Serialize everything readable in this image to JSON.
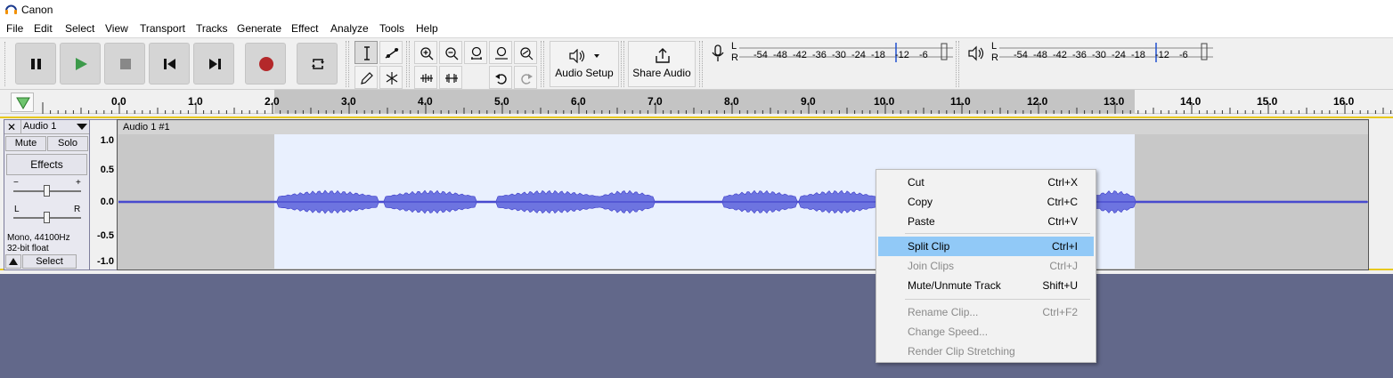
{
  "window": {
    "title": "Canon"
  },
  "menubar": [
    "File",
    "Edit",
    "Select",
    "View",
    "Transport",
    "Tracks",
    "Generate",
    "Effect",
    "Analyze",
    "Tools",
    "Help"
  ],
  "toolbar": {
    "audio_setup_label": "Audio Setup",
    "share_audio_label": "Share Audio"
  },
  "meters": {
    "record_channels": [
      "L",
      "R"
    ],
    "playback_channels": [
      "L",
      "R"
    ],
    "scale": [
      "-54",
      "-48",
      "-42",
      "-36",
      "-30",
      "-24",
      "-18",
      "-12",
      "-6"
    ]
  },
  "ruler": {
    "labels": [
      "0.0",
      "1.0",
      "2.0",
      "3.0",
      "4.0",
      "5.0",
      "6.0",
      "7.0",
      "8.0",
      "9.0",
      "10.0",
      "11.0",
      "12.0",
      "13.0",
      "14.0",
      "15.0",
      "16.0"
    ]
  },
  "track": {
    "name": "Audio 1",
    "mute_label": "Mute",
    "solo_label": "Solo",
    "effects_label": "Effects",
    "gain_minus": "−",
    "gain_plus": "+",
    "pan_left": "L",
    "pan_right": "R",
    "info_line1": "Mono, 44100Hz",
    "info_line2": "32-bit float",
    "select_label": "Select",
    "clip_name": "Audio 1 #1",
    "vertical_scale": [
      "1.0",
      "0.5",
      "0.0",
      "-0.5",
      "-1.0"
    ]
  },
  "context_menu": {
    "items": [
      {
        "label": "Cut",
        "shortcut": "Ctrl+X",
        "enabled": true
      },
      {
        "label": "Copy",
        "shortcut": "Ctrl+C",
        "enabled": true
      },
      {
        "label": "Paste",
        "shortcut": "Ctrl+V",
        "enabled": true
      },
      {
        "label": "Split Clip",
        "shortcut": "Ctrl+I",
        "enabled": true,
        "highlighted": true
      },
      {
        "label": "Join Clips",
        "shortcut": "Ctrl+J",
        "enabled": false
      },
      {
        "label": "Mute/Unmute Track",
        "shortcut": "Shift+U",
        "enabled": true
      },
      {
        "label": "Rename Clip...",
        "shortcut": "Ctrl+F2",
        "enabled": false
      },
      {
        "label": "Change Speed...",
        "shortcut": "",
        "enabled": false
      },
      {
        "label": "Render Clip Stretching",
        "shortcut": "",
        "enabled": false
      }
    ]
  },
  "colors": {
    "waveform": "#3c3cc8",
    "waveform_fill": "#6d74e0",
    "selection": "#e9f0fe",
    "record_red": "#b4282a",
    "play_green": "#3c9a4a",
    "highlight": "#91c9f7"
  }
}
